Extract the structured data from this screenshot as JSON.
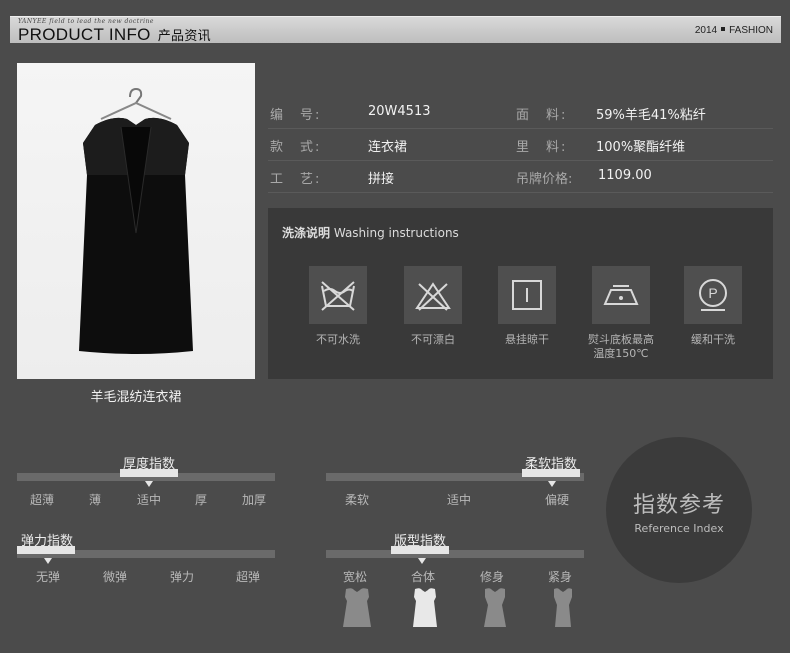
{
  "header": {
    "tagline": "YANYEE field to lead the new doctrine",
    "title_en": "PRODUCT INFO",
    "title_cn": "产品资讯",
    "year": "2014",
    "section": "FASHION"
  },
  "product": {
    "caption": "羊毛混纺连衣裙"
  },
  "info": {
    "code_label": "编　号:",
    "code_value": "20W4513",
    "style_label": "款　式:",
    "style_value": "连衣裙",
    "craft_label": "工　艺:",
    "craft_value": "拼接",
    "fabric_label": "面　料:",
    "fabric_value": "59%羊毛41%粘纤",
    "lining_label": "里　料:",
    "lining_value": "100%聚酯纤维",
    "price_label": "吊牌价格:",
    "price_value": "1109.00"
  },
  "washing": {
    "title_cn": "洗涤说明",
    "title_en": "Washing instructions",
    "items": [
      {
        "icon": "no-wash-icon",
        "label": "不可水洗"
      },
      {
        "icon": "no-bleach-icon",
        "label": "不可漂白"
      },
      {
        "icon": "hang-dry-icon",
        "label": "悬挂晾干"
      },
      {
        "icon": "iron-icon",
        "label": "熨斗底板最高",
        "label2": "温度150℃"
      },
      {
        "icon": "dry-clean-icon",
        "label": "缓和干洗"
      }
    ]
  },
  "indices": {
    "thickness": {
      "title": "厚度指数",
      "options": [
        "超薄",
        "薄",
        "适中",
        "厚",
        "加厚"
      ],
      "selected": "适中"
    },
    "softness": {
      "title": "柔软指数",
      "options": [
        "柔软",
        "适中",
        "偏硬"
      ],
      "selected": "偏硬"
    },
    "elasticity": {
      "title": "弹力指数",
      "options": [
        "无弹",
        "微弹",
        "弹力",
        "超弹"
      ],
      "selected": "无弹"
    },
    "fit": {
      "title": "版型指数",
      "options": [
        "宽松",
        "合体",
        "修身",
        "紧身"
      ],
      "selected": "合体"
    }
  },
  "reference": {
    "cn": "指数参考",
    "en": "Reference Index"
  },
  "colors": {
    "background": "#4b4b4b",
    "panel": "#393939",
    "highlight": "#e6e6e6"
  }
}
